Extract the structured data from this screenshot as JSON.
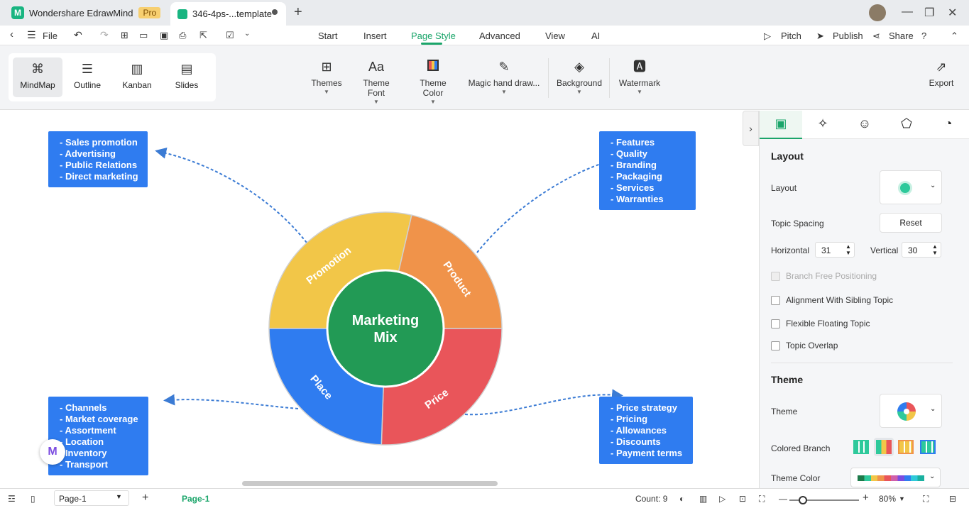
{
  "titlebar": {
    "app_name": "Wondershare EdrawMind",
    "badge": "Pro",
    "doc_tab": "346-4ps-...template",
    "new_tab": "+"
  },
  "menubar": {
    "file": "File",
    "items": [
      "Start",
      "Insert",
      "Page Style",
      "Advanced",
      "View",
      "AI"
    ],
    "active": "Page Style",
    "pitch": "Pitch",
    "publish": "Publish",
    "share": "Share"
  },
  "toolbar": {
    "views": [
      "MindMap",
      "Outline",
      "Kanban",
      "Slides"
    ],
    "selected_view": "MindMap",
    "tools": [
      "Themes",
      "Theme Font",
      "Theme Color",
      "Magic hand draw...",
      "Background",
      "Watermark"
    ],
    "export": "Export"
  },
  "mindmap": {
    "center": [
      "Marketing",
      "Mix"
    ],
    "segments": [
      {
        "label": "Promotion",
        "color": "#f2c648"
      },
      {
        "label": "Product",
        "color": "#f0934a"
      },
      {
        "label": "Price",
        "color": "#e9555a"
      },
      {
        "label": "Place",
        "color": "#2f7cf0"
      }
    ],
    "center_color": "#229a55",
    "box_color": "#2f7cf0",
    "promotion_items": [
      "- Sales promotion",
      "- Advertising",
      "- Public Relations",
      "- Direct marketing"
    ],
    "product_items": [
      "- Features",
      "- Quality",
      "- Branding",
      "- Packaging",
      "- Services",
      "- Warranties"
    ],
    "place_items": [
      "- Channels",
      "- Market coverage",
      "- Assortment",
      "- Location",
      "- Inventory",
      "- Transport"
    ],
    "price_items": [
      "- Price strategy",
      "- Pricing",
      "- Allowances",
      "- Discounts",
      "- Payment terms"
    ]
  },
  "panel": {
    "layout_heading": "Layout",
    "layout_label": "Layout",
    "topic_spacing": "Topic Spacing",
    "reset": "Reset",
    "horizontal_label": "Horizontal",
    "horizontal_value": "31",
    "vertical_label": "Vertical",
    "vertical_value": "30",
    "branch_free": "Branch Free Positioning",
    "alignment": "Alignment With Sibling Topic",
    "flexible": "Flexible Floating Topic",
    "overlap": "Topic Overlap",
    "theme_heading": "Theme",
    "theme_label": "Theme",
    "colored_branch": "Colored Branch",
    "theme_color": "Theme Color"
  },
  "statusbar": {
    "page_select": "Page-1",
    "page_tab": "Page-1",
    "count": "Count: 9",
    "zoom": "80%"
  }
}
